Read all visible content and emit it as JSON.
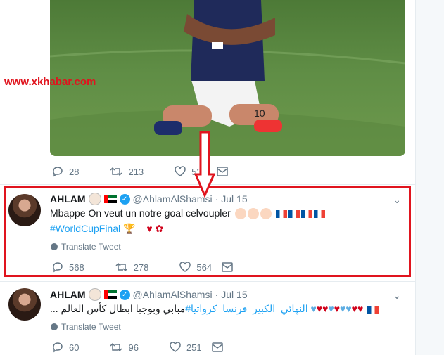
{
  "watermark": "www.xkhabar.com",
  "tweet0": {
    "actions": {
      "reply": "28",
      "retweet": "213",
      "like": "536"
    }
  },
  "tweet1": {
    "name": "AHLAM",
    "handle": "@AhlamAlShamsi",
    "dot": "·",
    "date": "Jul 15",
    "text": "Mbappe On veut un notre goal celvoupler",
    "hashtag": "#WorldCupFinal",
    "translate": "Translate Tweet",
    "actions": {
      "reply": "568",
      "retweet": "278",
      "like": "564"
    }
  },
  "tweet2": {
    "name": "AHLAM",
    "handle": "@AhlamAlShamsi",
    "dot": "·",
    "date": "Jul 15",
    "text": "مبابي وبوجبا ابطال  كأس العالم ...",
    "hashtag": "#النهائي_الكبير_فرنسا_كرواتيا",
    "translate": "Translate Tweet",
    "actions": {
      "reply": "60",
      "retweet": "96",
      "like": "251"
    }
  },
  "colors": {
    "highlight": "#e0141e",
    "link": "#1da1f2",
    "muted": "#657786"
  },
  "icons": [
    "reply-icon",
    "retweet-icon",
    "like-icon",
    "message-icon",
    "globe-icon",
    "chevron-down-icon",
    "verified-icon",
    "down-arrow-icon"
  ]
}
